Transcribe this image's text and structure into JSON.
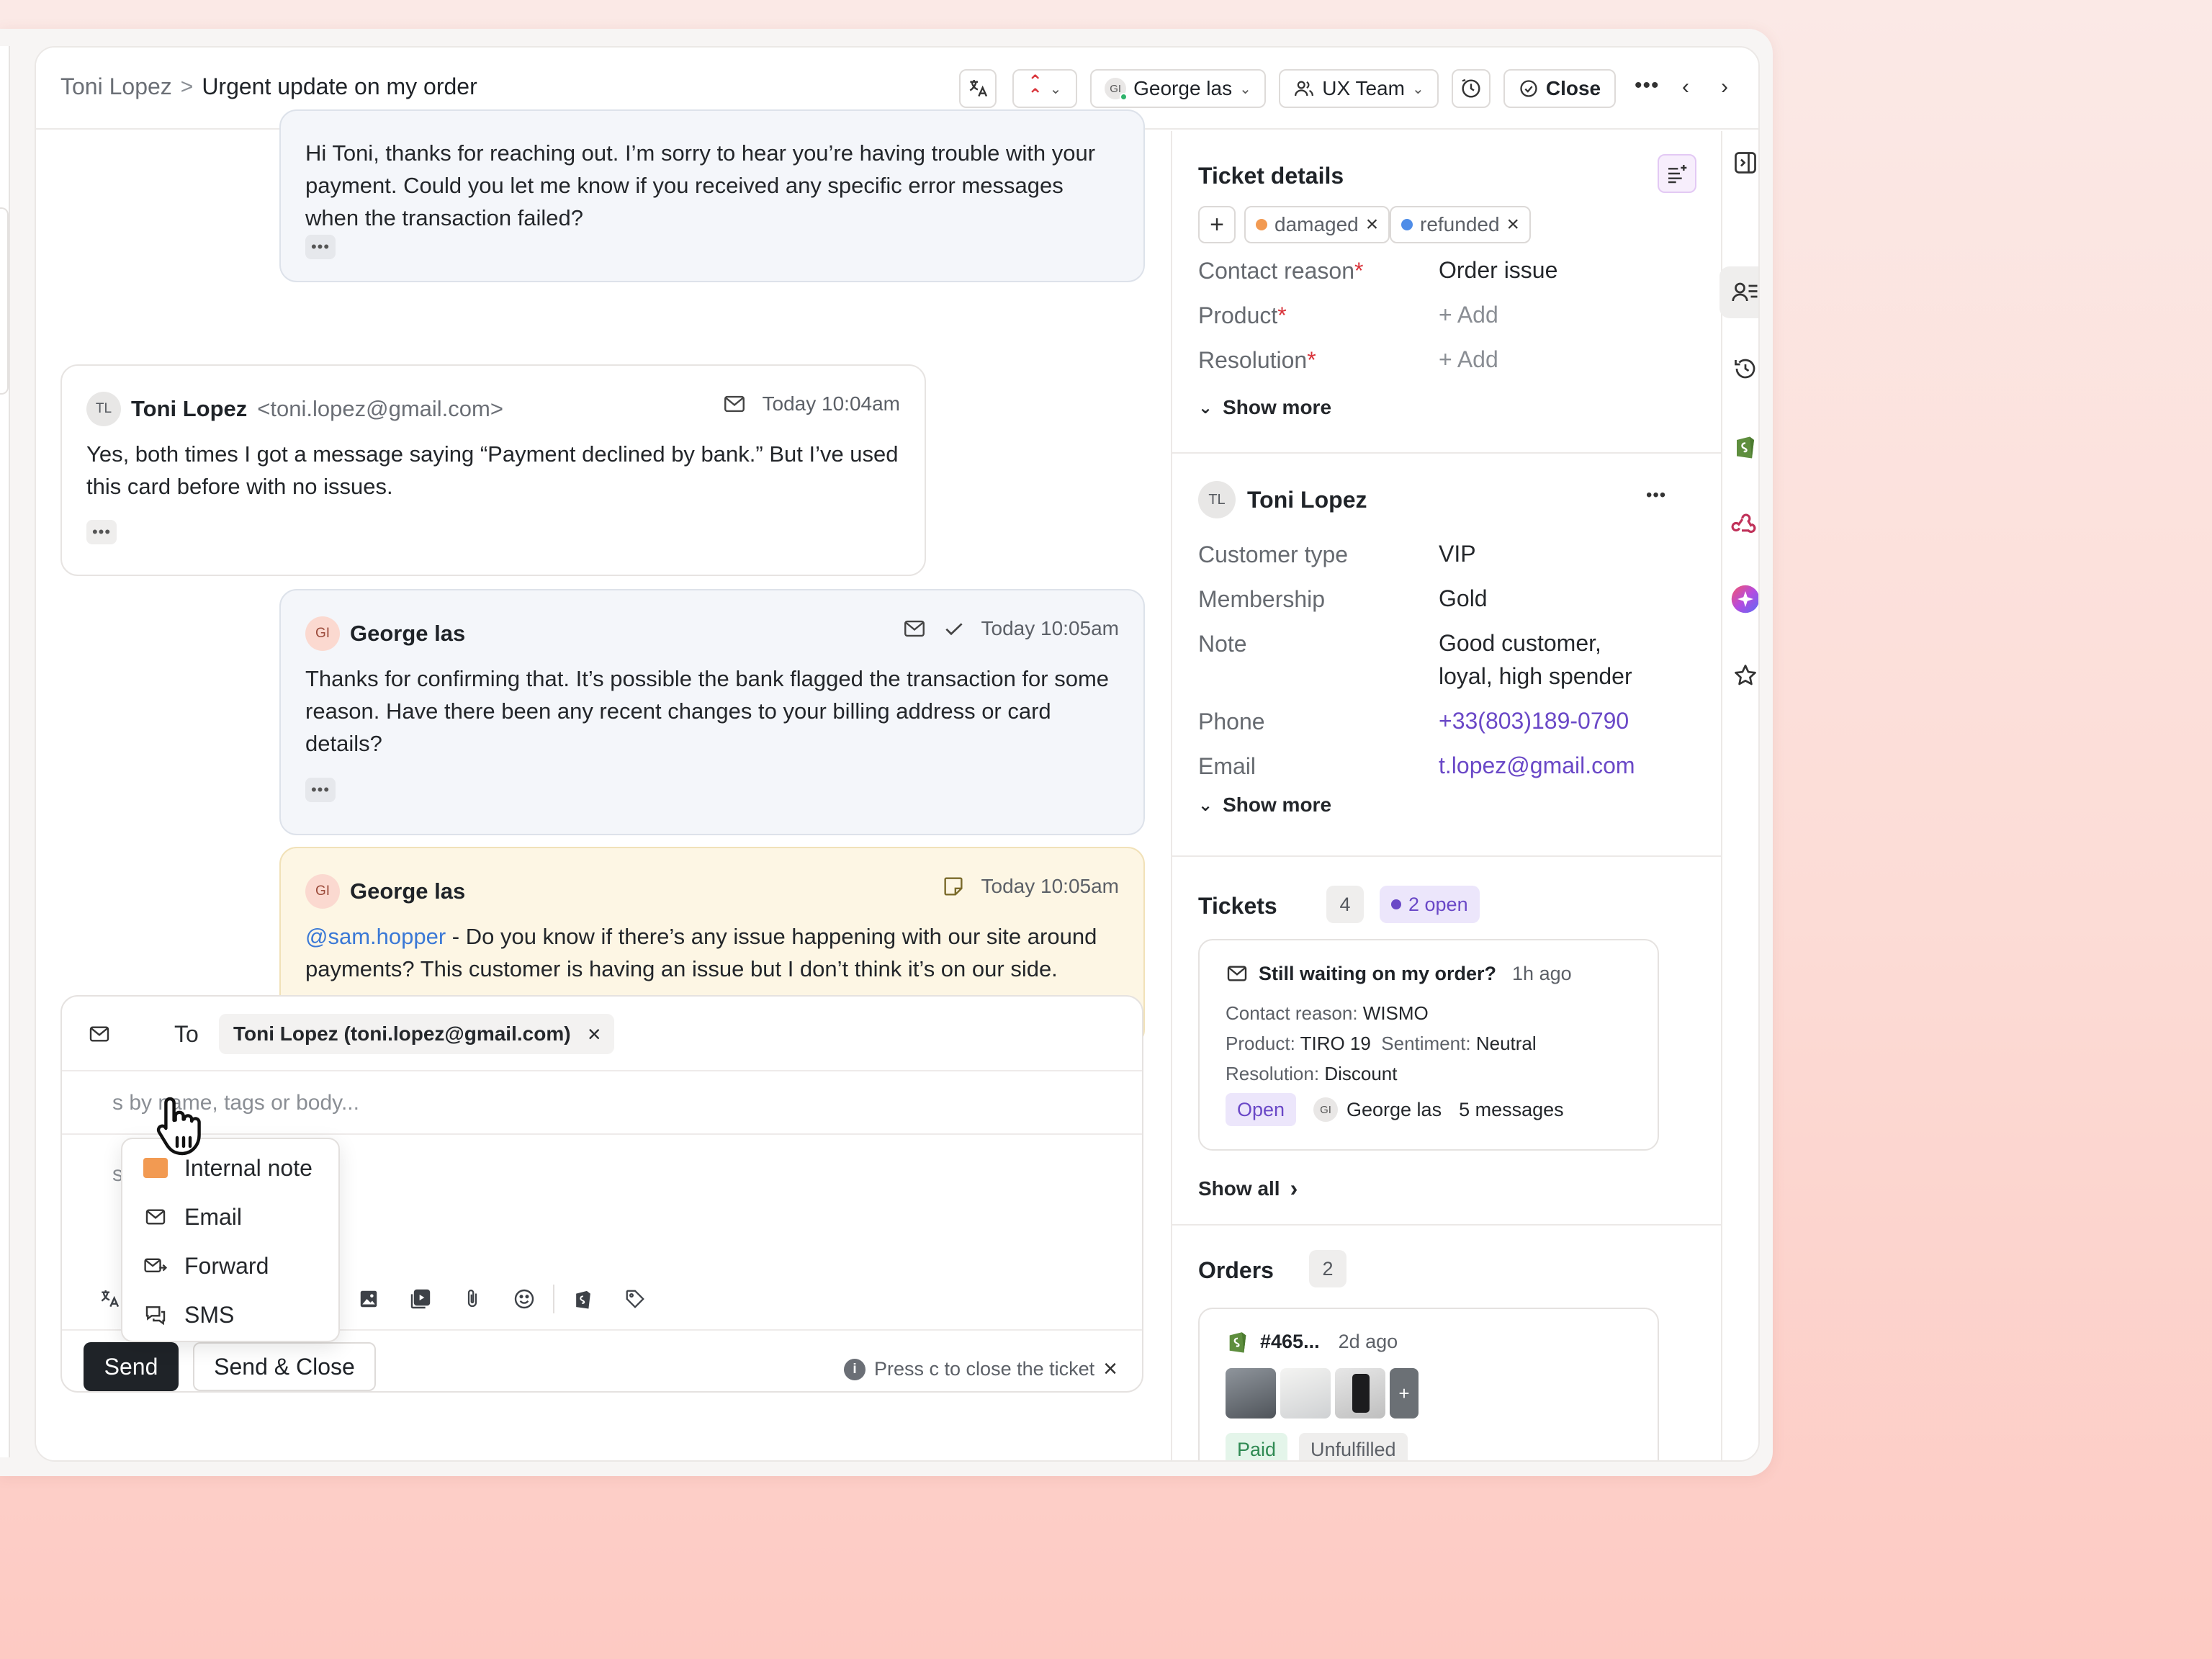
{
  "header": {
    "breadcrumb_parent": "Toni Lopez",
    "breadcrumb_sep": ">",
    "title": "Urgent update on my order",
    "assignee": "George las",
    "assignee_initials": "GI",
    "team": "UX Team",
    "close_label": "Close"
  },
  "messages": [
    {
      "body": "Hi Toni, thanks for reaching out. I’m sorry to hear you’re having trouble with your payment. Could you let me know if you received any specific error messages when the transaction failed?"
    },
    {
      "initials": "TL",
      "name": "Toni Lopez",
      "address": "<toni.lopez@gmail.com>",
      "time": "Today 10:04am",
      "body": "Yes, both times I got a message saying “Payment declined by bank.” But I’ve used this card before with no issues."
    },
    {
      "initials": "GI",
      "name": "George las",
      "time": "Today 10:05am",
      "body": "Thanks for confirming that. It’s possible the bank flagged the transaction for some reason. Have there been any recent changes to your billing address or card details?"
    },
    {
      "initials": "GI",
      "name": "George las",
      "time": "Today 10:05am",
      "mention": "@sam.hopper",
      "body": " - Do you know if there’s any issue happening with our site around payments? This customer is having an issue but I don’t think it’s on our side."
    }
  ],
  "composer": {
    "to_label": "To",
    "recipient": "Toni Lopez (toni.lopez@gmail.com)",
    "search_placeholder": "s by name, tags or body...",
    "body_fragment": "s",
    "send_label": "Send",
    "send_close_label": "Send & Close",
    "hint": "Press c to close the ticket",
    "channel_menu": [
      "Internal note",
      "Email",
      "Forward",
      "SMS"
    ]
  },
  "ticket_details": {
    "title": "Ticket details",
    "tags": [
      {
        "label": "damaged",
        "color": "#f29a52"
      },
      {
        "label": "refunded",
        "color": "#4f8de8"
      }
    ],
    "fields": [
      {
        "label": "Contact reason",
        "value": "Order issue"
      },
      {
        "label": "Product",
        "value": "+ Add"
      },
      {
        "label": "Resolution",
        "value": "+ Add"
      }
    ],
    "show_more": "Show more"
  },
  "customer": {
    "initials": "TL",
    "name": "Toni Lopez",
    "fields": [
      {
        "label": "Customer type",
        "value": "VIP"
      },
      {
        "label": "Membership",
        "value": "Gold"
      },
      {
        "label": "Note",
        "value": "Good customer, loyal, high spender"
      },
      {
        "label": "Phone",
        "value": "+33(803)189-0790"
      },
      {
        "label": "Email",
        "value": "t.lopez@gmail.com"
      }
    ],
    "show_more": "Show more"
  },
  "tickets": {
    "title": "Tickets",
    "count": "4",
    "open": "2 open",
    "card": {
      "subject": "Still waiting on my order?",
      "age": "1h ago",
      "contact_reason_label": "Contact reason:",
      "contact_reason": "WISMO",
      "product_label": "Product:",
      "product": "TIRO 19",
      "sentiment_label": "Sentiment:",
      "sentiment": "Neutral",
      "resolution_label": "Resolution:",
      "resolution": "Discount",
      "status": "Open",
      "assignee_initials": "GI",
      "assignee": "George las",
      "messages": "5 messages"
    },
    "show_all": "Show all"
  },
  "orders": {
    "title": "Orders",
    "count": "2",
    "card": {
      "number": "#465...",
      "age": "2d ago",
      "payment": "Paid",
      "fulfillment": "Unfulfilled"
    }
  }
}
